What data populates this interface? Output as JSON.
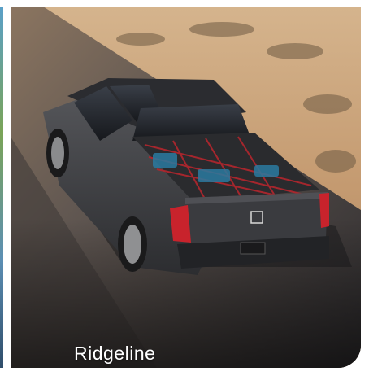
{
  "card": {
    "title": "Ridgeline",
    "image_icon": "pickup-truck-photo",
    "colors": {
      "sand": "#c9a37a",
      "road": "#4a4744",
      "truck_body": "#3b3c3f",
      "taillight": "#c8232c",
      "label_text": "#ffffff"
    }
  },
  "neighbor_cards": {
    "left_edge_icon": "adjacent-card-edge"
  }
}
